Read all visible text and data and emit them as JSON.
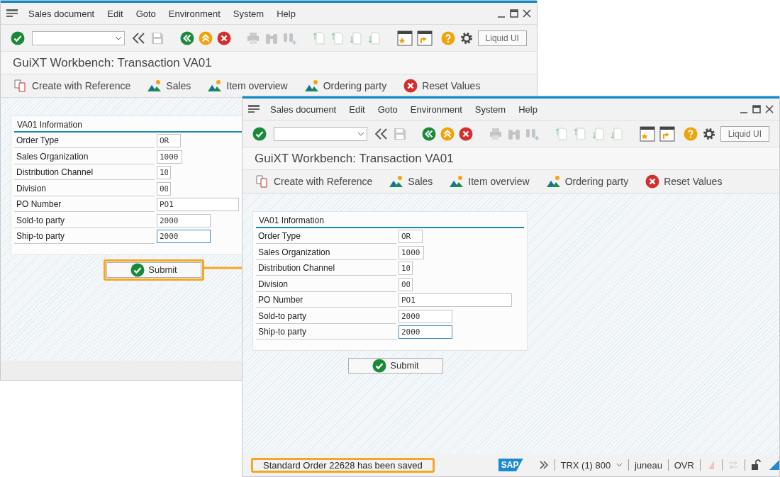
{
  "windows": [
    {
      "menu": [
        "Sales document",
        "Edit",
        "Goto",
        "Environment",
        "System",
        "Help"
      ],
      "toolbar": {
        "liquid_ui_button": "Liquid UI"
      },
      "title": "GuiXT Workbench: Transaction VA01",
      "app_toolbar": [
        {
          "label": "Create with Reference",
          "kind": "reference"
        },
        {
          "label": "Sales",
          "kind": "mountain"
        },
        {
          "label": "Item overview",
          "kind": "mountain"
        },
        {
          "label": "Ordering party",
          "kind": "mountain"
        },
        {
          "label": "Reset Values",
          "kind": "cancel"
        }
      ],
      "form": {
        "title": "VA01 Information",
        "fields": [
          {
            "label": "Order Type",
            "value": "OR",
            "focused": false
          },
          {
            "label": "Sales Organization",
            "value": "1000",
            "focused": false
          },
          {
            "label": "Distribution Channel",
            "value": "10",
            "focused": false
          },
          {
            "label": "Division",
            "value": "00",
            "focused": false
          },
          {
            "label": "PO Number",
            "value": "PO1",
            "focused": false
          },
          {
            "label": "Sold-to party",
            "value": "2000",
            "focused": false
          },
          {
            "label": "Ship-to party",
            "value": "2000",
            "focused": true
          }
        ]
      },
      "submit": {
        "label": "Submit",
        "highlighted": true
      }
    },
    {
      "menu": [
        "Sales document",
        "Edit",
        "Goto",
        "Environment",
        "System",
        "Help"
      ],
      "toolbar": {
        "liquid_ui_button": "Liquid UI"
      },
      "title": "GuiXT Workbench: Transaction VA01",
      "app_toolbar": [
        {
          "label": "Create with Reference",
          "kind": "reference"
        },
        {
          "label": "Sales",
          "kind": "mountain"
        },
        {
          "label": "Item overview",
          "kind": "mountain"
        },
        {
          "label": "Ordering party",
          "kind": "mountain"
        },
        {
          "label": "Reset Values",
          "kind": "cancel"
        }
      ],
      "form": {
        "title": "VA01 Information",
        "fields": [
          {
            "label": "Order Type",
            "value": "OR",
            "focused": false
          },
          {
            "label": "Sales Organization",
            "value": "1000",
            "focused": false
          },
          {
            "label": "Distribution Channel",
            "value": "10",
            "focused": false
          },
          {
            "label": "Division",
            "value": "00",
            "focused": false
          },
          {
            "label": "PO Number",
            "value": "PO1",
            "focused": false
          },
          {
            "label": "Sold-to party",
            "value": "2000",
            "focused": false
          },
          {
            "label": "Ship-to party",
            "value": "2000",
            "focused": true
          }
        ]
      },
      "submit": {
        "label": "Submit",
        "highlighted": false
      },
      "status_bar": {
        "message": "Standard Order 22628 has been saved",
        "highlighted": true,
        "logo": "SAP",
        "system": "TRX (1) 800",
        "user": "juneau",
        "mode": "OVR"
      }
    }
  ]
}
